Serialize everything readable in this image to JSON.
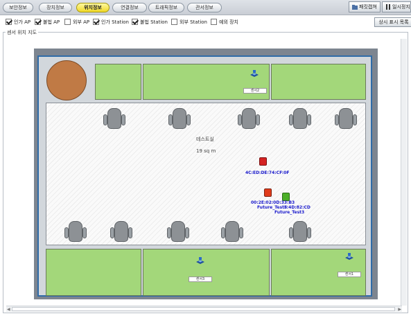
{
  "tabs": [
    {
      "label": "보안정보",
      "active": false
    },
    {
      "label": "장치정보",
      "active": false
    },
    {
      "label": "위치정보",
      "active": true
    },
    {
      "label": "연결정보",
      "active": false
    },
    {
      "label": "트래픽정보",
      "active": false
    },
    {
      "label": "관서정보",
      "active": false
    }
  ],
  "toolbar": {
    "save_label": "패킷캡쳐",
    "pause_label": "일시정지"
  },
  "filters": [
    {
      "label": "인가 AP",
      "checked": true
    },
    {
      "label": "불법 AP",
      "checked": true
    },
    {
      "label": "외부 AP",
      "checked": false
    },
    {
      "label": "인가 Station",
      "checked": true
    },
    {
      "label": "불법 Station",
      "checked": true
    },
    {
      "label": "외부 Station",
      "checked": false
    },
    {
      "label": "예외 장치",
      "checked": false
    }
  ],
  "detail_button_label": "상시 표시 목록",
  "panel_title": "센서 위치 지도",
  "map": {
    "room_name": "테스트실",
    "room_area": "19 sq m",
    "sensors": [
      {
        "label": "센서2",
        "icon": "sensor-icon"
      },
      {
        "label": "센서3",
        "icon": "sensor-icon"
      },
      {
        "label": "센서1",
        "icon": "sensor-icon"
      }
    ],
    "devices": [
      {
        "label": "4C:ED:DE:74:CF:0F",
        "icon": "station-icon",
        "color": "#d42222"
      },
      {
        "label": "00:2E:02:0D:33:B3",
        "icon": "illegal-ap-icon",
        "color": "#e03b1a"
      },
      {
        "label": "Future_Test5",
        "icon": "illegal-ap-icon",
        "color": "#e03b1a"
      },
      {
        "label": "F:4D:82:CD",
        "icon": "authorized-ap-icon",
        "color": "#4caf28"
      },
      {
        "label": "Future_Test3",
        "icon": "authorized-ap-icon",
        "color": "#4caf28"
      }
    ]
  },
  "colors": {
    "active_tab": "#f0d826",
    "room_green": "#a3d77a",
    "round_table": "#c07a45",
    "map_frame": "#2f6ba8"
  }
}
